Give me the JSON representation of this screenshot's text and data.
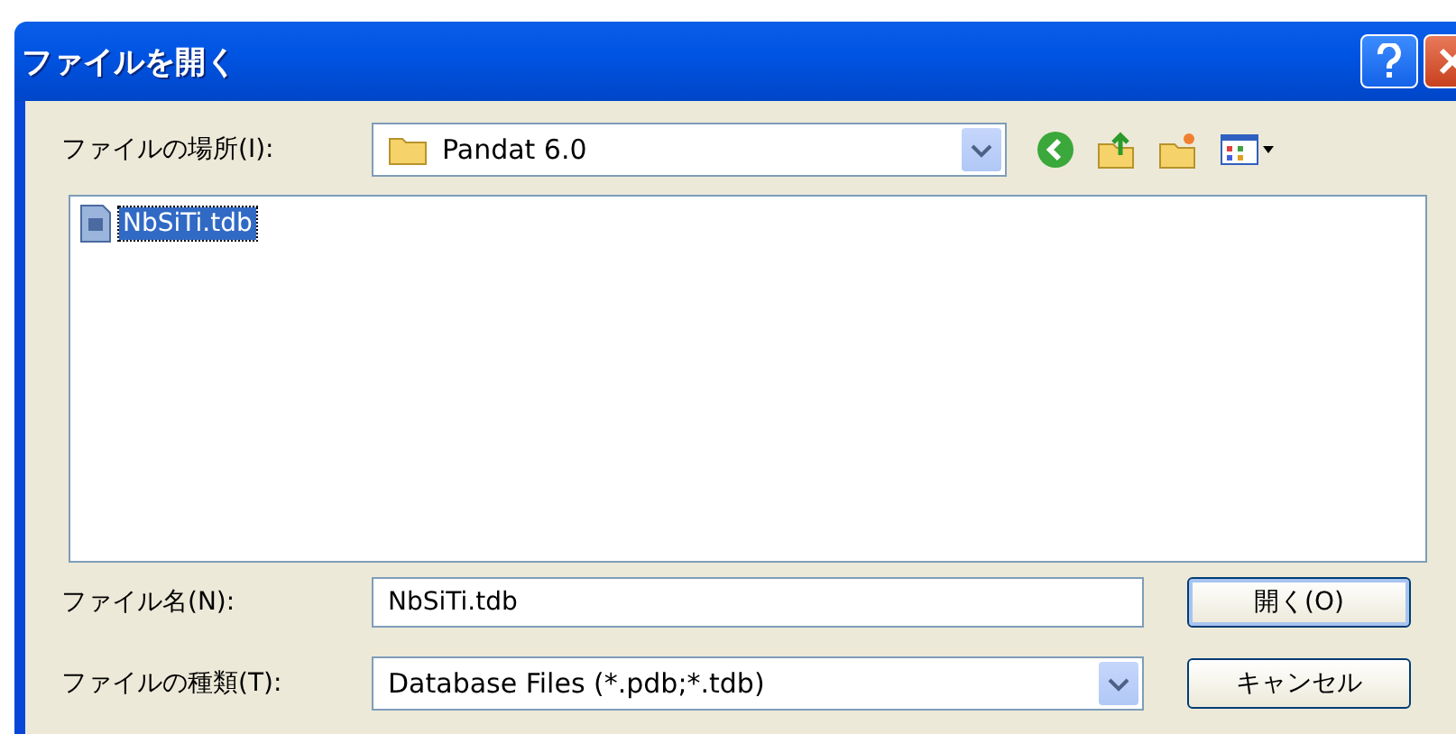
{
  "window": {
    "title": "ファイルを開く"
  },
  "look_in": {
    "label": "ファイルの場所(I):",
    "value": "Pandat 6.0"
  },
  "files": [
    {
      "name": "NbSiTi.tdb",
      "selected": true
    }
  ],
  "file_name": {
    "label": "ファイル名(N):",
    "value": "NbSiTi.tdb"
  },
  "file_type": {
    "label": "ファイルの種類(T):",
    "value": "Database Files (*.pdb;*.tdb)"
  },
  "buttons": [
    "開く(O)",
    "キャンセル"
  ]
}
